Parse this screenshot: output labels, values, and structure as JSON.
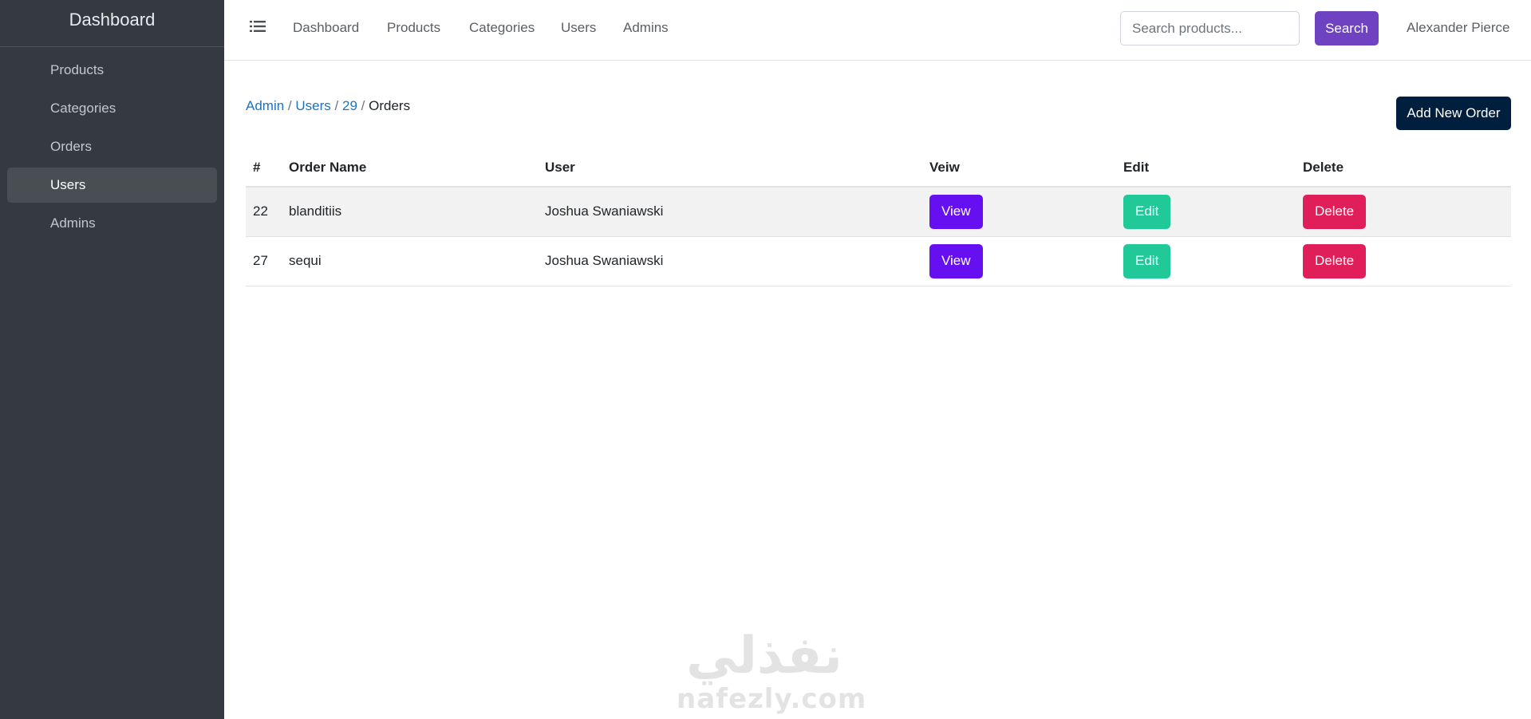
{
  "sidebar": {
    "brand": "Dashboard",
    "items": [
      {
        "label": "Products"
      },
      {
        "label": "Categories"
      },
      {
        "label": "Orders"
      },
      {
        "label": "Users",
        "active": true
      },
      {
        "label": "Admins"
      }
    ]
  },
  "topbar": {
    "menu_icon": "list-icon",
    "links": [
      "Dashboard",
      "Products",
      "Categories",
      "Users",
      "Admins"
    ],
    "search_placeholder": "Search products...",
    "search_value": "",
    "search_button": "Search",
    "user_name": "Alexander Pierce"
  },
  "breadcrumb": {
    "admin": "Admin",
    "users": "Users",
    "user_id": "29",
    "current": "Orders",
    "separator": "/"
  },
  "add_button": "Add New Order",
  "table": {
    "headers": [
      "#",
      "Order Name",
      "User",
      "Veiw",
      "Edit",
      "Delete"
    ],
    "rows": [
      {
        "id": "22",
        "order_name": "blanditiis",
        "user": "Joshua Swaniawski",
        "view": "View",
        "edit": "Edit",
        "delete": "Delete"
      },
      {
        "id": "27",
        "order_name": "sequi",
        "user": "Joshua Swaniawski",
        "view": "View",
        "edit": "Edit",
        "delete": "Delete"
      }
    ]
  },
  "watermark": {
    "arabic": "نفذلي",
    "latin": "nafezly.com"
  },
  "colors": {
    "sidebar_bg": "#343a40",
    "search_button": "#6f42c1",
    "add_button": "#001f3f",
    "view_button": "#6610f2",
    "edit_button": "#20c997",
    "delete_button": "#e01e5a",
    "link": "#1e73be"
  }
}
